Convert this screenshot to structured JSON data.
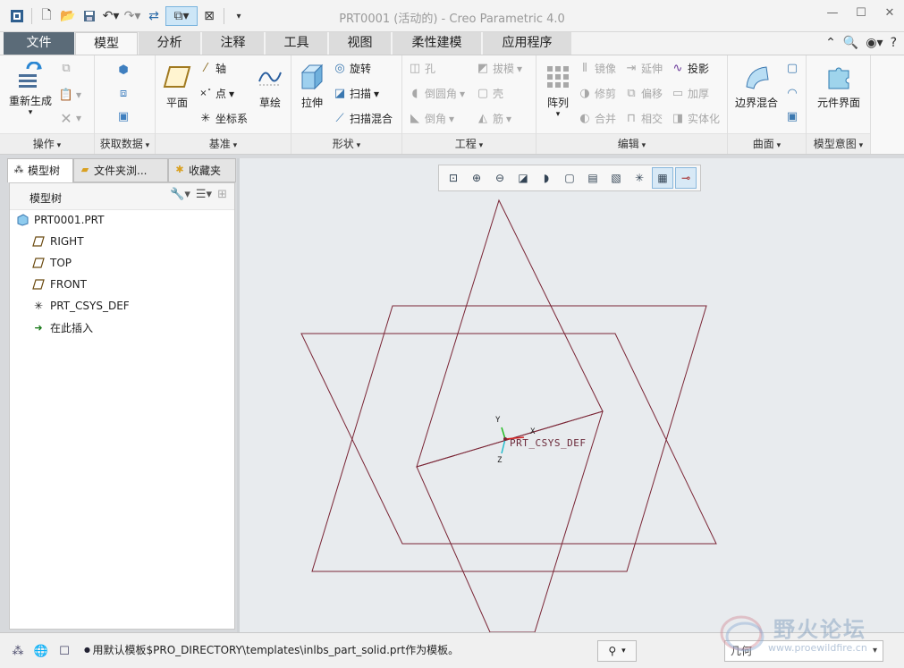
{
  "window": {
    "title": "PRT0001 (活动的) - Creo Parametric 4.0"
  },
  "colors": {
    "datum_plane": "#7a2535",
    "file_tab": "#5b6b78",
    "axis_x": "#d42020",
    "axis_y": "#22bb22",
    "axis_z": "#22bbcc"
  },
  "ribbon_tabs": [
    {
      "label": "文件"
    },
    {
      "label": "模型"
    },
    {
      "label": "分析"
    },
    {
      "label": "注释"
    },
    {
      "label": "工具"
    },
    {
      "label": "视图"
    },
    {
      "label": "柔性建模"
    },
    {
      "label": "应用程序"
    }
  ],
  "ribbon": {
    "operations": {
      "name": "操作",
      "regenerate": "重新生成"
    },
    "get_data": {
      "name": "获取数据"
    },
    "datum": {
      "name": "基准",
      "plane": "平面",
      "axis": "轴",
      "point": "点",
      "csys": "坐标系",
      "sketch": "草绘"
    },
    "shapes": {
      "name": "形状",
      "extrude": "拉伸",
      "revolve": "旋转",
      "sweep": "扫描",
      "swept_blend": "扫描混合"
    },
    "engineering": {
      "name": "工程",
      "hole": "孔",
      "draft": "拔模",
      "round": "倒圆角",
      "shell": "壳",
      "chamfer": "倒角",
      "rib": "筋"
    },
    "editing": {
      "name": "编辑",
      "pattern": "阵列",
      "mirror": "镜像",
      "extend": "延伸",
      "project": "投影",
      "trim": "修剪",
      "offset": "偏移",
      "thicken": "加厚",
      "merge": "合并",
      "intersect": "相交",
      "solidify": "实体化"
    },
    "surfaces": {
      "name": "曲面",
      "boundary_blend": "边界混合"
    },
    "model_intent": {
      "name": "模型意图",
      "component_interface": "元件界面"
    }
  },
  "nav_tabs": [
    {
      "label": "模型树"
    },
    {
      "label": "文件夹浏..."
    },
    {
      "label": "收藏夹"
    }
  ],
  "model_tree": {
    "header": "模型树",
    "items": [
      {
        "label": "PRT0001.PRT",
        "icon": "part-icon"
      },
      {
        "label": "RIGHT",
        "icon": "datum-plane-icon"
      },
      {
        "label": "TOP",
        "icon": "datum-plane-icon"
      },
      {
        "label": "FRONT",
        "icon": "datum-plane-icon"
      },
      {
        "label": "PRT_CSYS_DEF",
        "icon": "csys-icon"
      },
      {
        "label": "在此插入",
        "icon": "insert-here-arrow-icon"
      }
    ]
  },
  "graphics": {
    "csys_label": "PRT_CSYS_DEF",
    "axis_x": "X",
    "axis_y": "Y",
    "axis_z": "Z"
  },
  "status": {
    "message": "用默认模板$PRO_DIRECTORY\\templates\\inlbs_part_solid.prt作为模板。",
    "filter_value": "几何"
  },
  "watermark": {
    "title": "野火论坛",
    "url": "www.proewildfire.cn"
  }
}
